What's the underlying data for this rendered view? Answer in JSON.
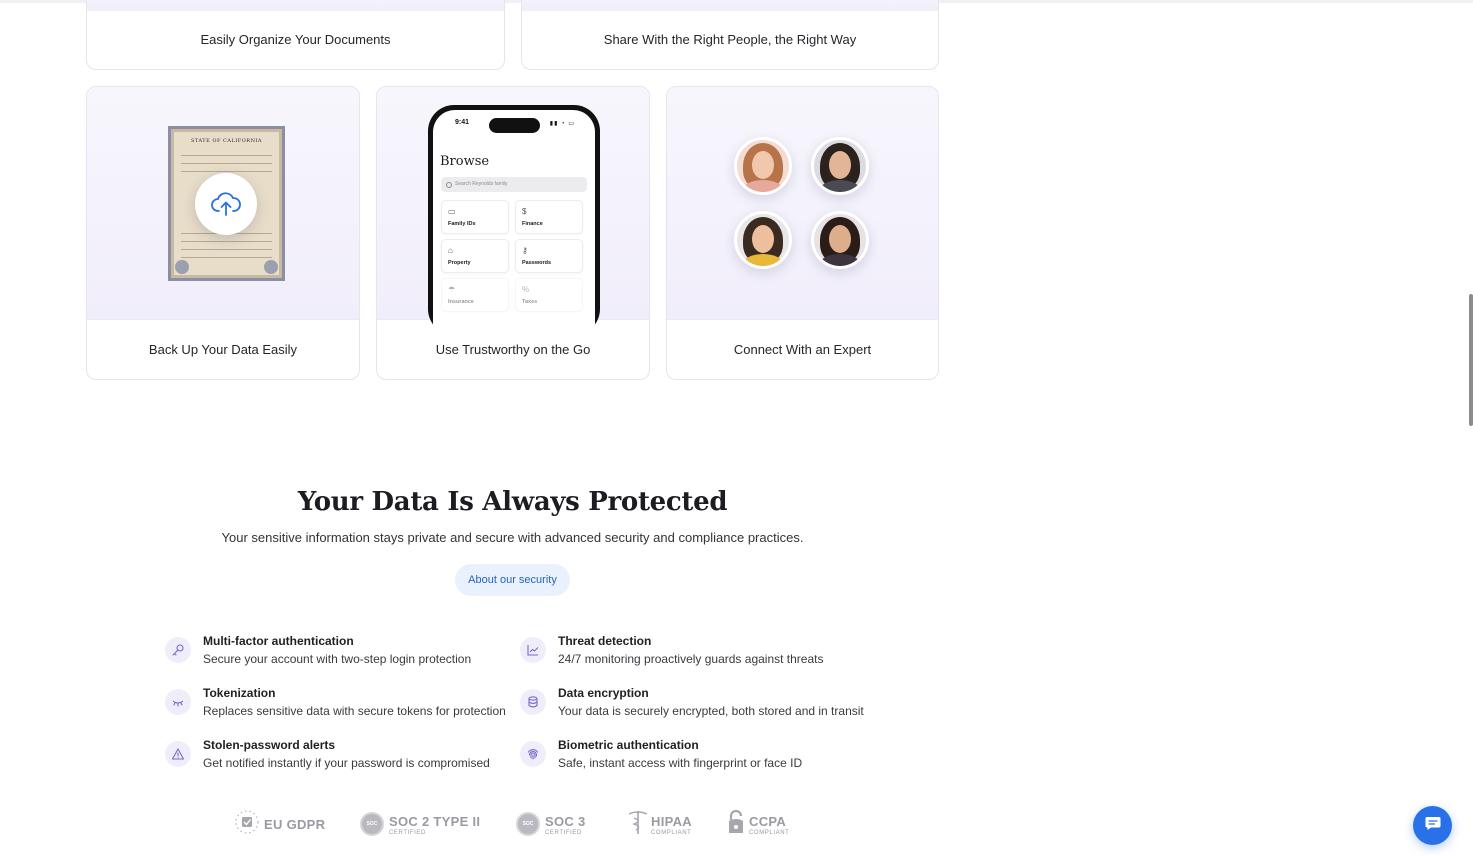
{
  "cards": {
    "organize": "Easily Organize Your Documents",
    "share": "Share With the Right People, the Right Way",
    "backup": "Back Up Your Data Easily",
    "mobile": "Use Trustworthy on the Go",
    "expert": "Connect With an Expert"
  },
  "certificate": {
    "title": "STATE OF CALIFORNIA"
  },
  "phone": {
    "time": "9:41",
    "heading": "Browse",
    "search_placeholder": "Search Reynolds family",
    "tiles": [
      "Family IDs",
      "Finance",
      "Property",
      "Passwords",
      "Insurance",
      "Taxes"
    ]
  },
  "security": {
    "title": "Your Data Is Always Protected",
    "subtitle": "Your sensitive information stays private and secure with advanced security and compliance practices.",
    "button": "About our security",
    "features": [
      {
        "title": "Multi-factor authentication",
        "desc": "Secure your account with two-step login protection",
        "icon": "key-icon"
      },
      {
        "title": "Threat detection",
        "desc": "24/7 monitoring proactively guards against threats",
        "icon": "chart-line-icon"
      },
      {
        "title": "Tokenization",
        "desc": "Replaces sensitive data with secure tokens for protection",
        "icon": "eye-closed-icon"
      },
      {
        "title": "Data encryption",
        "desc": "Your data is securely encrypted, both stored and in transit",
        "icon": "database-icon"
      },
      {
        "title": "Stolen-password alerts",
        "desc": "Get notified instantly if your password is compromised",
        "icon": "warning-icon"
      },
      {
        "title": "Biometric authentication",
        "desc": "Safe, instant access with fingerprint or face ID",
        "icon": "fingerprint-icon"
      }
    ]
  },
  "badges": {
    "gdpr": "EU GDPR",
    "soc2": "SOC 2 TYPE II",
    "soc2_sub": "CERTIFIED",
    "soc3": "SOC 3",
    "soc3_sub": "CERTIFIED",
    "hipaa": "HIPAA",
    "hipaa_sub": "COMPLIANT",
    "ccpa": "CCPA",
    "ccpa_sub": "COMPLIANT",
    "soc_circle": "SOC"
  },
  "colors": {
    "accent": "#2871e8",
    "link": "#2464c8",
    "icon_bg": "#f0edfa",
    "icon_stroke": "#7b68c9"
  }
}
